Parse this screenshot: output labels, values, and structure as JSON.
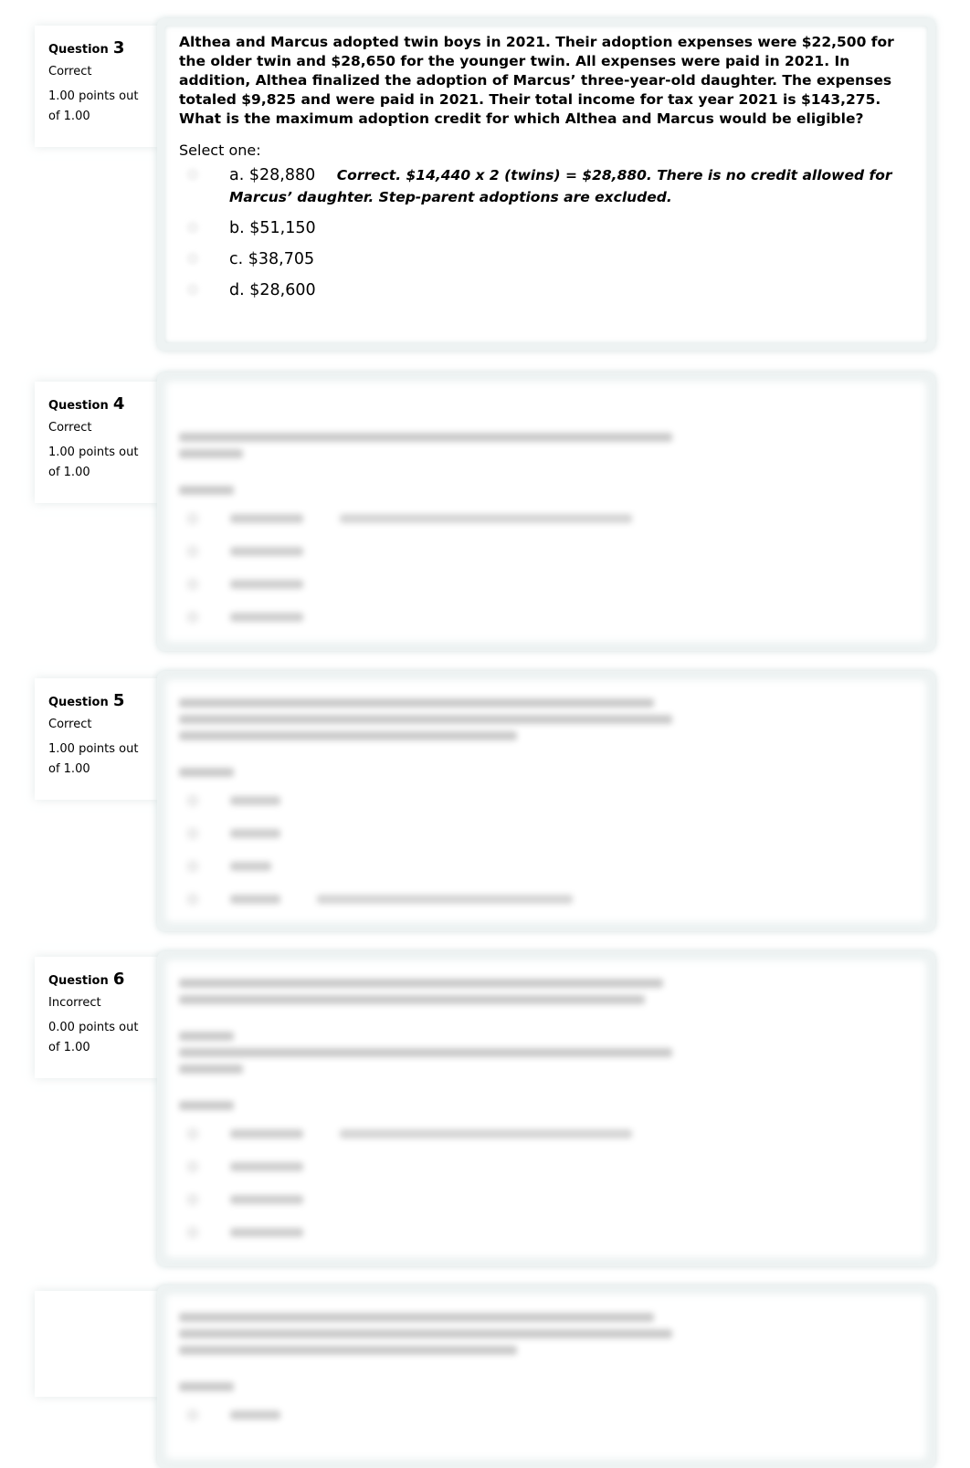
{
  "questions": [
    {
      "label": "Question",
      "number": "3",
      "state": "Correct",
      "grade_line1": "1.00 points out",
      "grade_line2": "of 1.00",
      "text": "Althea and Marcus adopted twin boys in 2021. Their adoption expenses were $22,500 for the older twin and $28,650 for the younger twin. All expenses were paid in 2021. In addition, Althea finalized the adoption of Marcus’ three-year-old daughter. The expenses totaled $9,825 and were paid in 2021. Their total income for tax year 2021 is $143,275. What is the maximum adoption credit for which Althea and Marcus would be eligible?",
      "prompt": "Select one:",
      "options": [
        {
          "label": "a. $28,880",
          "feedback": "Correct. $14,440 x 2 (twins) = $28,880. There is no credit allowed for Marcus’ daughter. Step-parent adoptions are excluded.",
          "selected": true
        },
        {
          "label": "b. $51,150",
          "selected": false
        },
        {
          "label": "c. $38,705",
          "selected": false
        },
        {
          "label": "d. $28,600",
          "selected": false
        }
      ]
    },
    {
      "label": "Question",
      "number": "4",
      "state": "Correct",
      "grade_line1": "1.00 points out",
      "grade_line2": "of 1.00",
      "content_blurred": true
    },
    {
      "label": "Question",
      "number": "5",
      "state": "Correct",
      "grade_line1": "1.00 points out",
      "grade_line2": "of 1.00",
      "content_blurred": true
    },
    {
      "label": "Question",
      "number": "6",
      "state": "Incorrect",
      "grade_line1": "0.00 points out",
      "grade_line2": "of 1.00",
      "content_blurred": true
    }
  ],
  "colors": {
    "content_bg": "#eef3f3",
    "text": "#000000"
  }
}
